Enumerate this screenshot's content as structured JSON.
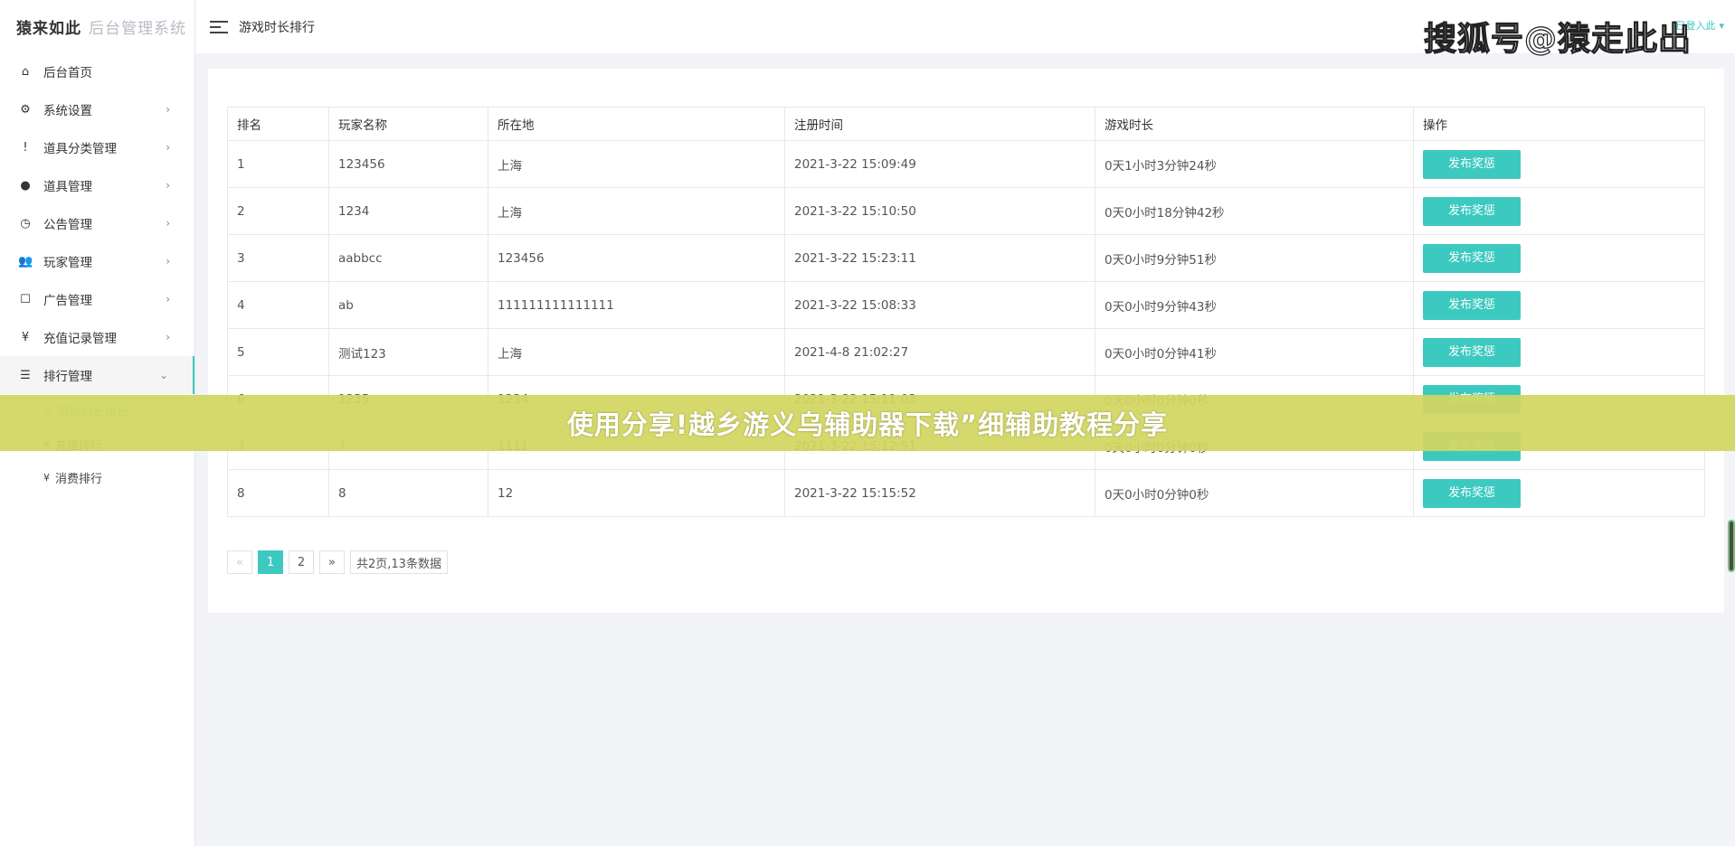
{
  "app": {
    "brand": "猿来如此",
    "system_name": "后台管理系统"
  },
  "header": {
    "page_name": "游戏时长排行",
    "user_label": "已登入此",
    "watermark": "搜狐号@猿走此出"
  },
  "sidebar": {
    "items": [
      {
        "icon": "home-icon",
        "glyph": "⌂",
        "label": "后台首页",
        "arrow": ""
      },
      {
        "icon": "gear-icon",
        "glyph": "⚙",
        "label": "系统设置",
        "arrow": "›"
      },
      {
        "icon": "alert-icon",
        "glyph": "!",
        "label": "道具分类管理",
        "arrow": "›"
      },
      {
        "icon": "bulb-icon",
        "glyph": "●",
        "label": "道具管理",
        "arrow": "›"
      },
      {
        "icon": "alarm-clock-icon",
        "glyph": "◷",
        "label": "公告管理",
        "arrow": "›"
      },
      {
        "icon": "users-icon",
        "glyph": "👥",
        "label": "玩家管理",
        "arrow": "›"
      },
      {
        "icon": "square-icon",
        "glyph": "☐",
        "label": "广告管理",
        "arrow": "›"
      },
      {
        "icon": "yen-icon",
        "glyph": "¥",
        "label": "充值记录管理",
        "arrow": "›"
      },
      {
        "icon": "list-icon",
        "glyph": "☰",
        "label": "排行管理",
        "arrow": "⌄"
      }
    ],
    "sub_items": [
      {
        "icon": "clock-icon",
        "glyph": "◷",
        "label": "游戏时长排行"
      },
      {
        "icon": "yen-icon",
        "glyph": "¥",
        "label": "充值排行"
      },
      {
        "icon": "yen-icon",
        "glyph": "¥",
        "label": "消费排行"
      }
    ]
  },
  "table": {
    "headers": [
      "排名",
      "玩家名称",
      "所在地",
      "注册时间",
      "游戏时长",
      "操作"
    ],
    "rows": [
      {
        "rank": "1",
        "name": "123456",
        "location": "上海",
        "registered": "2021-3-22 15:09:49",
        "duration": "0天1小时3分钟24秒",
        "action": "发布奖惩"
      },
      {
        "rank": "2",
        "name": "1234",
        "location": "上海",
        "registered": "2021-3-22 15:10:50",
        "duration": "0天0小时18分钟42秒",
        "action": "发布奖惩"
      },
      {
        "rank": "3",
        "name": "aabbcc",
        "location": "123456",
        "registered": "2021-3-22 15:23:11",
        "duration": "0天0小时9分钟51秒",
        "action": "发布奖惩"
      },
      {
        "rank": "4",
        "name": "ab",
        "location": "111111111111111",
        "registered": "2021-3-22 15:08:33",
        "duration": "0天0小时9分钟43秒",
        "action": "发布奖惩"
      },
      {
        "rank": "5",
        "name": "测试123",
        "location": "上海",
        "registered": "2021-4-8 21:02:27",
        "duration": "0天0小时0分钟41秒",
        "action": "发布奖惩"
      },
      {
        "rank": "6",
        "name": "1235",
        "location": "1234",
        "registered": "2021-3-22 15:11:03",
        "duration": "0天0小时0分钟0秒",
        "action": "发布奖惩"
      },
      {
        "rank": "7",
        "name": "7",
        "location": "1111",
        "registered": "2021-3-22 15:12:51",
        "duration": "0天0小时0分钟0秒",
        "action": "发布奖惩"
      },
      {
        "rank": "8",
        "name": "8",
        "location": "12",
        "registered": "2021-3-22 15:15:52",
        "duration": "0天0小时0分钟0秒",
        "action": "发布奖惩"
      }
    ]
  },
  "pagination": {
    "prev": "«",
    "pages": [
      "1",
      "2"
    ],
    "current": "1",
    "next": "»",
    "summary": "共2页,13条数据"
  },
  "banner": {
    "text": "使用分享!越乡游义乌辅助器下载”细辅助教程分享"
  },
  "colors": {
    "accent": "#3cc9c0",
    "banner": "#d2d660"
  }
}
